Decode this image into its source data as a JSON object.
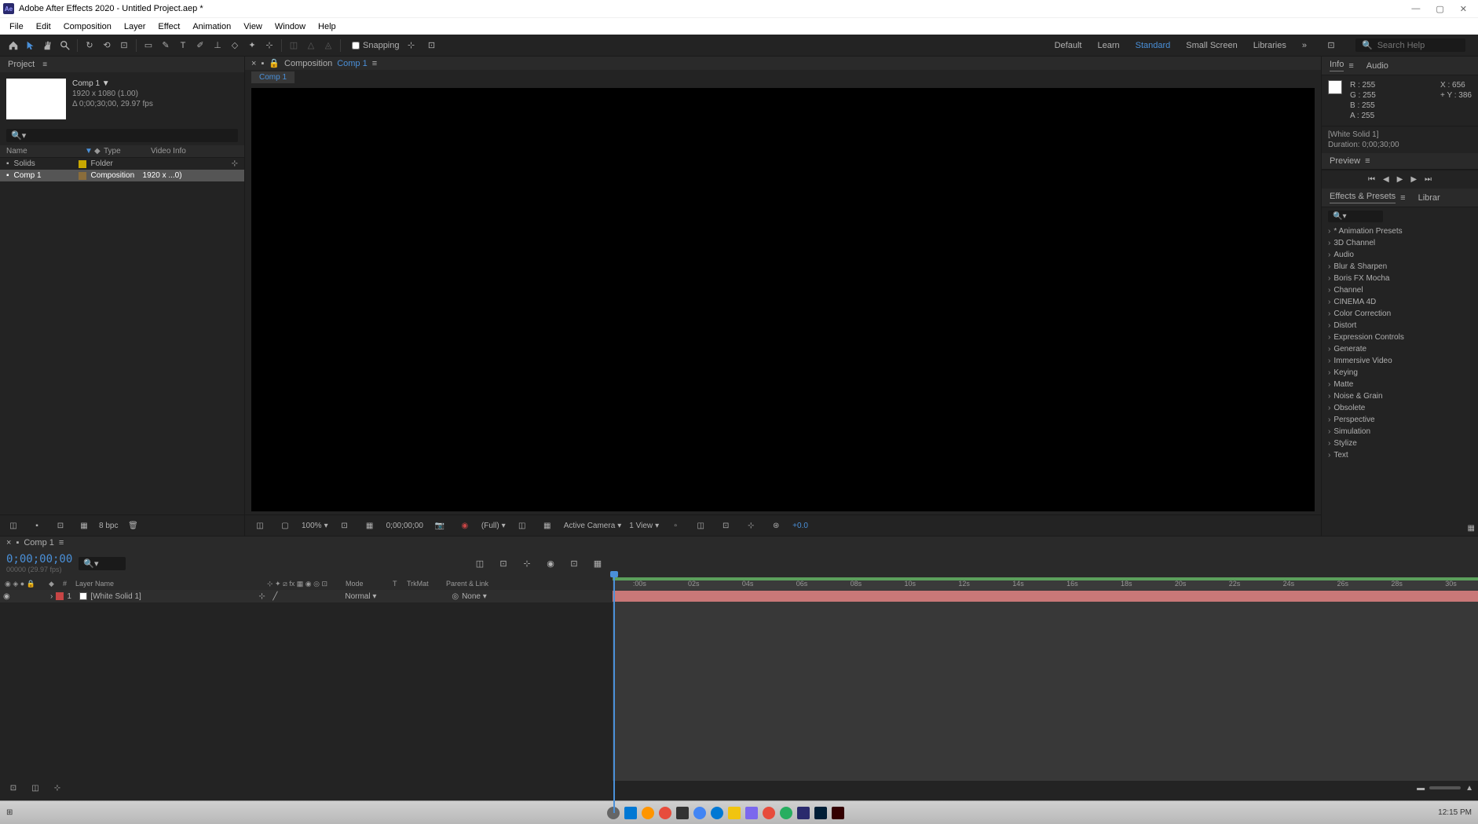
{
  "title": "Adobe After Effects 2020 - Untitled Project.aep *",
  "menu": [
    "File",
    "Edit",
    "Composition",
    "Layer",
    "Effect",
    "Animation",
    "View",
    "Window",
    "Help"
  ],
  "toolbar": {
    "snapping": "Snapping"
  },
  "workspaces": {
    "items": [
      "Default",
      "Learn",
      "Standard",
      "Small Screen",
      "Libraries"
    ],
    "active": "Standard"
  },
  "search_help": {
    "placeholder": "Search Help"
  },
  "project": {
    "tab": "Project",
    "comp_name": "Comp 1",
    "dimensions": "1920 x 1080 (1.00)",
    "duration": "Δ 0;00;30;00, 29.97 fps",
    "headers": {
      "name": "Name",
      "type": "Type",
      "video": "Video Info"
    },
    "items": [
      {
        "name": "Solids",
        "type": "Folder",
        "video": ""
      },
      {
        "name": "Comp 1",
        "type": "Composition",
        "video": "1920 x ...0)"
      }
    ],
    "bpc": "8 bpc"
  },
  "comp": {
    "tab": "Composition",
    "name": "Comp 1",
    "crumb": "Comp 1"
  },
  "viewer": {
    "zoom": "100%",
    "time": "0;00;00;00",
    "res": "(Full)",
    "camera": "Active Camera",
    "views": "1 View",
    "exposure": "+0.0"
  },
  "info": {
    "tab1": "Info",
    "tab2": "Audio",
    "r": "R : 255",
    "g": "G : 255",
    "b": "B : 255",
    "a": "A : 255",
    "x": "X : 656",
    "y": "Y : 386",
    "layer": "[White Solid 1]",
    "duration": "Duration: 0;00;30;00"
  },
  "preview": {
    "tab": "Preview"
  },
  "effects": {
    "tab": "Effects & Presets",
    "tab2": "Librar",
    "cats": [
      "* Animation Presets",
      "3D Channel",
      "Audio",
      "Blur & Sharpen",
      "Boris FX Mocha",
      "Channel",
      "CINEMA 4D",
      "Color Correction",
      "Distort",
      "Expression Controls",
      "Generate",
      "Immersive Video",
      "Keying",
      "Matte",
      "Noise & Grain",
      "Obsolete",
      "Perspective",
      "Simulation",
      "Stylize",
      "Text"
    ]
  },
  "timeline": {
    "tab": "Comp 1",
    "time": "0;00;00;00",
    "time_sub": "00000 (29.97 fps)",
    "col_layername": "Layer Name",
    "col_mode": "Mode",
    "col_trkmat": "TrkMat",
    "col_parent": "Parent & Link",
    "ticks": [
      ":00s",
      "02s",
      "04s",
      "06s",
      "08s",
      "10s",
      "12s",
      "14s",
      "16s",
      "18s",
      "20s",
      "22s",
      "24s",
      "26s",
      "28s",
      "30s"
    ],
    "layer": {
      "num": "1",
      "name": "[White Solid 1]",
      "mode": "Normal",
      "parent": "None"
    }
  },
  "taskbar": {
    "time": "12:15 PM"
  }
}
